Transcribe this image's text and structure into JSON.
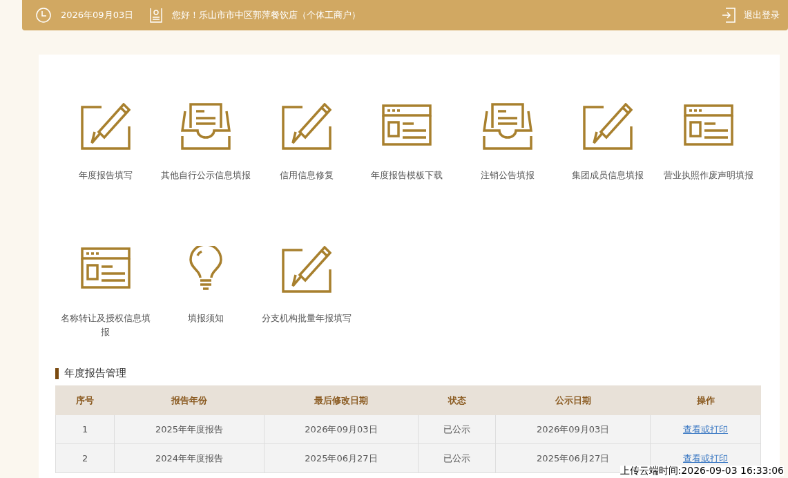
{
  "header": {
    "date": "2026年09月03日",
    "greeting": "您好！乐山市市中区郭萍餐饮店（个体工商户）",
    "logout": "退出登录"
  },
  "functions": [
    {
      "label": "年度报告填写",
      "kind": "edit"
    },
    {
      "label": "其他自行公示信息填报",
      "kind": "tray"
    },
    {
      "label": "信用信息修复",
      "kind": "edit"
    },
    {
      "label": "年度报告模板下载",
      "kind": "window"
    },
    {
      "label": "注销公告填报",
      "kind": "tray"
    },
    {
      "label": "集团成员信息填报",
      "kind": "edit"
    },
    {
      "label": "营业执照作废声明填报",
      "kind": "window"
    },
    {
      "label": "名称转让及授权信息填报",
      "kind": "window"
    },
    {
      "label": "填报须知",
      "kind": "bulb"
    },
    {
      "label": "分支机构批量年报填写",
      "kind": "edit"
    }
  ],
  "section_title": "年度报告管理",
  "table": {
    "columns": [
      "序号",
      "报告年份",
      "最后修改日期",
      "状态",
      "公示日期",
      "操作"
    ],
    "rows": [
      {
        "cells": [
          "1",
          "2025年年度报告",
          "2026年09月03日",
          "已公示",
          "2026年09月03日"
        ],
        "action": "查看或打印"
      },
      {
        "cells": [
          "2",
          "2024年年度报告",
          "2025年06月27日",
          "已公示",
          "2025年06月27日"
        ],
        "action": "查看或打印"
      }
    ]
  },
  "upload_stamp": "上传云端时间:2026-09-03 16:33:06"
}
